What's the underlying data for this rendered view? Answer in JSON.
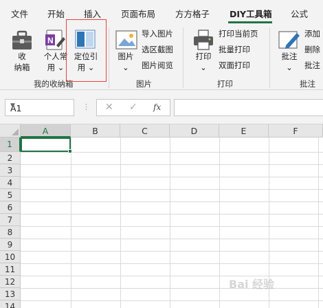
{
  "tabs": [
    "文件",
    "开始",
    "插入",
    "页面布局",
    "方方格子",
    "DIY工具箱",
    "公式"
  ],
  "active_tab": "DIY工具箱",
  "ribbon": {
    "box_group": {
      "collect_top": "收",
      "collect_bottom": "纳箱",
      "personal_top": "个人常",
      "personal_bottom": "用 ⌄",
      "locate_top": "定位引",
      "locate_bottom": "用 ⌄",
      "label": "我的收纳箱"
    },
    "image_group": {
      "image_top": "图片",
      "image_bottom": "⌄",
      "import": "导入图片",
      "screenshot": "选区截图",
      "browse": "图片阅览",
      "label": "图片"
    },
    "print_group": {
      "print_top": "打印",
      "print_bottom": "⌄",
      "print_current": "打印当前页",
      "batch_print": "批量打印",
      "duplex_print": "双面打印",
      "label": "打印"
    },
    "comment_group": {
      "comment_top": "批注",
      "comment_bottom": "⌄",
      "add": "添加",
      "delete": "删除",
      "annot": "批注",
      "label": "批注"
    }
  },
  "formula_bar": {
    "name_box": "A1",
    "cancel_symbol": "✕",
    "enter_symbol": "✓",
    "fx_label": "fx",
    "formula": ""
  },
  "grid": {
    "columns": [
      "A",
      "B",
      "C",
      "D",
      "E",
      "F"
    ],
    "rows": [
      "1",
      "2",
      "3",
      "4",
      "5",
      "6",
      "7",
      "8",
      "9",
      "10",
      "11",
      "12",
      "13",
      "14"
    ],
    "active_cell": "A1"
  },
  "colors": {
    "accent": "#217346",
    "highlight_box": "#e8423f"
  },
  "watermark": "Bai 经验"
}
